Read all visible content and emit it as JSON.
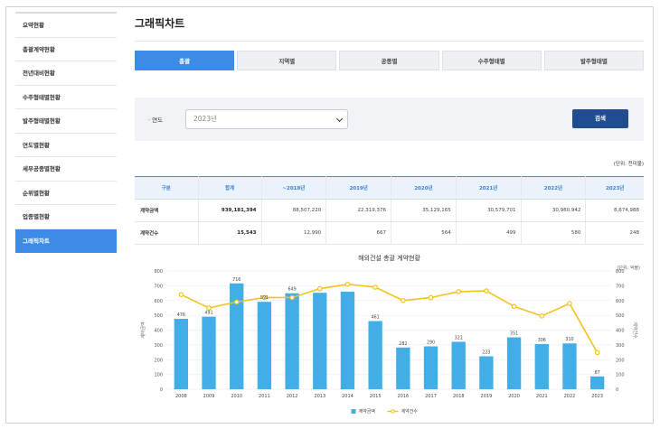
{
  "sidebar": {
    "items": [
      {
        "label": "요약현황",
        "active": false
      },
      {
        "label": "총괄계약현황",
        "active": false
      },
      {
        "label": "전년대비현황",
        "active": false
      },
      {
        "label": "수주형태별현황",
        "active": false
      },
      {
        "label": "발주형태별현황",
        "active": false
      },
      {
        "label": "연도별현황",
        "active": false
      },
      {
        "label": "세부공종별현황",
        "active": false
      },
      {
        "label": "순위별현황",
        "active": false
      },
      {
        "label": "업종별현황",
        "active": false
      },
      {
        "label": "그래픽차트",
        "active": true
      }
    ]
  },
  "page": {
    "title": "그래픽차트"
  },
  "tabs": [
    {
      "label": "총괄",
      "active": true
    },
    {
      "label": "지역별",
      "active": false
    },
    {
      "label": "공종별",
      "active": false
    },
    {
      "label": "수주형태별",
      "active": false
    },
    {
      "label": "발주형태별",
      "active": false
    }
  ],
  "search": {
    "year_label": "· 연도",
    "year_value": "2023년",
    "button_label": "검색"
  },
  "table": {
    "unit_note": "(단위: 천미불)",
    "headers": [
      "구분",
      "합계",
      "~2018년",
      "2019년",
      "2020년",
      "2021년",
      "2022년",
      "2023년"
    ],
    "rows": [
      {
        "label": "계약금액",
        "total": "939,181,394",
        "values": [
          "88,507,220",
          "22,319,376",
          "35,129,165",
          "30,579,701",
          "30,980,942",
          "8,674,988"
        ]
      },
      {
        "label": "계약건수",
        "total": "15,543",
        "values": [
          "12,990",
          "667",
          "564",
          "499",
          "580",
          "248"
        ]
      }
    ]
  },
  "chart_data": {
    "type": "bar",
    "title": "해외건설 총괄 계약현황",
    "categories": [
      "2008",
      "2009",
      "2010",
      "2011",
      "2012",
      "2013",
      "2014",
      "2015",
      "2016",
      "2017",
      "2018",
      "2019",
      "2020",
      "2021",
      "2022",
      "2023"
    ],
    "series": [
      {
        "name": "계약금액",
        "type": "bar",
        "axis": "left",
        "color": "#41aee6",
        "values": [
          476,
          491,
          716,
          591,
          649,
          652,
          660,
          461,
          282,
          290,
          321,
          223,
          351,
          306,
          310,
          87
        ]
      },
      {
        "name": "계약건수",
        "type": "line",
        "axis": "right",
        "color": "#f2c21f",
        "values": [
          640,
          550,
          590,
          620,
          620,
          680,
          710,
          690,
          600,
          620,
          660,
          665,
          560,
          495,
          580,
          248
        ]
      }
    ],
    "data_labels": [
      "476",
      "491",
      "716",
      "591",
      "649",
      "",
      "",
      "461",
      "282",
      "290",
      "321",
      "223",
      "351",
      "306",
      "310",
      "87"
    ],
    "ylabel": "계약금액",
    "ylabel_right": "계약건수",
    "unit_note": "(단위: 억불)",
    "ylim": [
      0,
      800
    ],
    "ylim_right": [
      0,
      800
    ],
    "yticks": [
      0,
      100,
      200,
      300,
      400,
      500,
      600,
      700,
      800
    ],
    "grid": true,
    "legend": "bottom-center"
  }
}
